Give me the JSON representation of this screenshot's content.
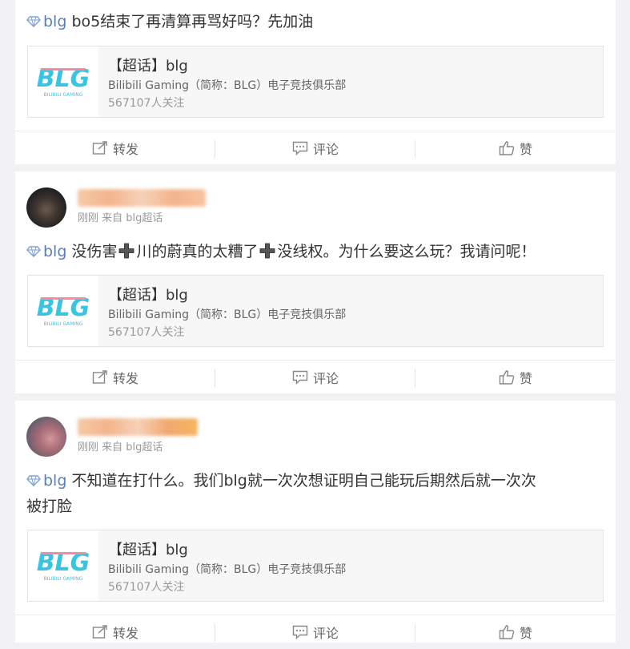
{
  "posts": [
    {
      "topic": "blg",
      "content": "bo5结束了再清算再骂好吗？先加油",
      "card": {
        "title": "【超话】blg",
        "desc": "Bilibili Gaming（简称：BLG）电子竞技俱乐部",
        "followers": "567107人关注",
        "logo_text": "BLG",
        "logo_sub": "BILIBILI GAMING"
      },
      "actions": {
        "repost": "转发",
        "comment": "评论",
        "like": "赞"
      }
    },
    {
      "meta": "刚刚 来自 blg超话",
      "topic": "blg",
      "content_a": "没伤害",
      "content_b": "川的蔚真的太糟了",
      "content_c": "没线权。为什么要这么玩？我请问呢！",
      "card": {
        "title": "【超话】blg",
        "desc": "Bilibili Gaming（简称：BLG）电子竞技俱乐部",
        "followers": "567107人关注",
        "logo_text": "BLG",
        "logo_sub": "BILIBILI GAMING"
      },
      "actions": {
        "repost": "转发",
        "comment": "评论",
        "like": "赞"
      }
    },
    {
      "meta": "刚刚 来自 blg超话",
      "topic": "blg",
      "content_line1": "不知道在打什么。我们blg就一次次想证明自己能玩后期然后就一次次",
      "content_line2": "被打脸",
      "card": {
        "title": "【超话】blg",
        "desc": "Bilibili Gaming（简称：BLG）电子竞技俱乐部",
        "followers": "567107人关注",
        "logo_text": "BLG",
        "logo_sub": "BILIBILI GAMING"
      },
      "actions": {
        "repost": "转发",
        "comment": "评论",
        "like": "赞"
      }
    }
  ],
  "colors": {
    "topic_link": "#5b7fb3",
    "logo_cyan": "#3ec3df",
    "logo_pink": "#f28ca0"
  }
}
